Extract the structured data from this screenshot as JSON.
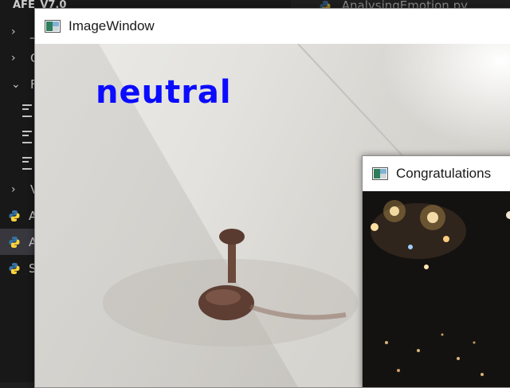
{
  "explorer": {
    "project_name": "AFE_V7.0",
    "rows": [
      {
        "kind": "folder-collapsed",
        "label": "_"
      },
      {
        "kind": "folder-collapsed",
        "label": "C"
      },
      {
        "kind": "folder-expanded",
        "label": "F"
      },
      {
        "kind": "file",
        "label": ""
      },
      {
        "kind": "file",
        "label": ""
      },
      {
        "kind": "file",
        "label": ""
      },
      {
        "kind": "folder-collapsed",
        "label": "V"
      },
      {
        "kind": "python",
        "label": "A"
      },
      {
        "kind": "python",
        "label": "A",
        "selected": true
      },
      {
        "kind": "python",
        "label": "S"
      }
    ]
  },
  "editor": {
    "tab_label": "AnalysingEmotion.py"
  },
  "image_window": {
    "title": "ImageWindow",
    "emotion_text": "neutral",
    "emotion_color": "#0b0bff"
  },
  "congrats_window": {
    "title": "Congratulations"
  },
  "colors": {
    "vscode_bg": "#181818",
    "selection": "#37373d",
    "python_blue": "#3572a5",
    "python_yellow": "#ffd43b"
  }
}
